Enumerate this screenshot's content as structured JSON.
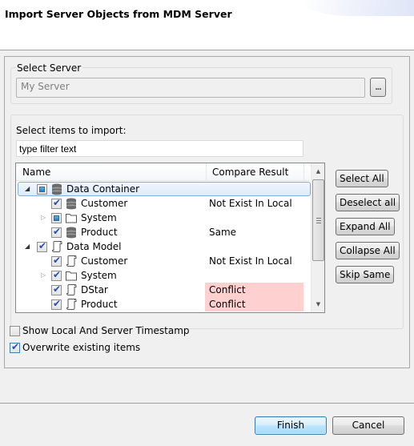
{
  "dialog": {
    "title": "Import Server Objects from MDM Server"
  },
  "server": {
    "group_label": "Select Server",
    "value": "My Server",
    "browse_label": "..."
  },
  "items": {
    "label": "Select items to import:",
    "filter_placeholder": "type filter text",
    "columns": {
      "name": "Name",
      "compare_result": "Compare Result"
    },
    "rows": [
      {
        "name": "Data Container",
        "result": "",
        "level": 0,
        "twisty": "expanded",
        "check": "partial",
        "icon": "database-icon",
        "selected": true,
        "conflict": false
      },
      {
        "name": "Customer",
        "result": "Not Exist In Local",
        "level": 1,
        "twisty": "none",
        "check": "checked",
        "icon": "database-icon",
        "selected": false,
        "conflict": false
      },
      {
        "name": "System",
        "result": "",
        "level": 1,
        "twisty": "collapsed",
        "check": "partial",
        "icon": "folder-icon",
        "selected": false,
        "conflict": false
      },
      {
        "name": "Product",
        "result": "Same",
        "level": 1,
        "twisty": "none",
        "check": "checked",
        "icon": "database-icon",
        "selected": false,
        "conflict": false
      },
      {
        "name": "Data Model",
        "result": "",
        "level": 0,
        "twisty": "expanded",
        "check": "checked",
        "icon": "scroll-icon",
        "selected": false,
        "conflict": false
      },
      {
        "name": "Customer",
        "result": "Not Exist In Local",
        "level": 1,
        "twisty": "none",
        "check": "checked",
        "icon": "scroll-icon",
        "selected": false,
        "conflict": false
      },
      {
        "name": "System",
        "result": "",
        "level": 1,
        "twisty": "collapsed",
        "check": "checked",
        "icon": "folder-icon",
        "selected": false,
        "conflict": false
      },
      {
        "name": "DStar",
        "result": "Conflict",
        "level": 1,
        "twisty": "none",
        "check": "checked",
        "icon": "scroll-icon",
        "selected": false,
        "conflict": true
      },
      {
        "name": "Product",
        "result": "Conflict",
        "level": 1,
        "twisty": "none",
        "check": "checked",
        "icon": "scroll-icon",
        "selected": false,
        "conflict": true
      }
    ]
  },
  "side_buttons": [
    {
      "label": "Select All"
    },
    {
      "label": "Deselect all"
    },
    {
      "label": "Expand All"
    },
    {
      "label": "Collapse All"
    },
    {
      "label": "Skip Same"
    }
  ],
  "options": {
    "show_timestamp": {
      "label": "Show Local And Server Timestamp",
      "checked": false
    },
    "overwrite": {
      "label": "Overwrite existing items",
      "checked": true
    }
  },
  "footer": {
    "finish_label": "Finish",
    "cancel_label": "Cancel"
  },
  "colors": {
    "conflict_bg": "#ffd0d0",
    "selection_border": "#84acdd",
    "default_button_border": "#3c7fb1"
  }
}
